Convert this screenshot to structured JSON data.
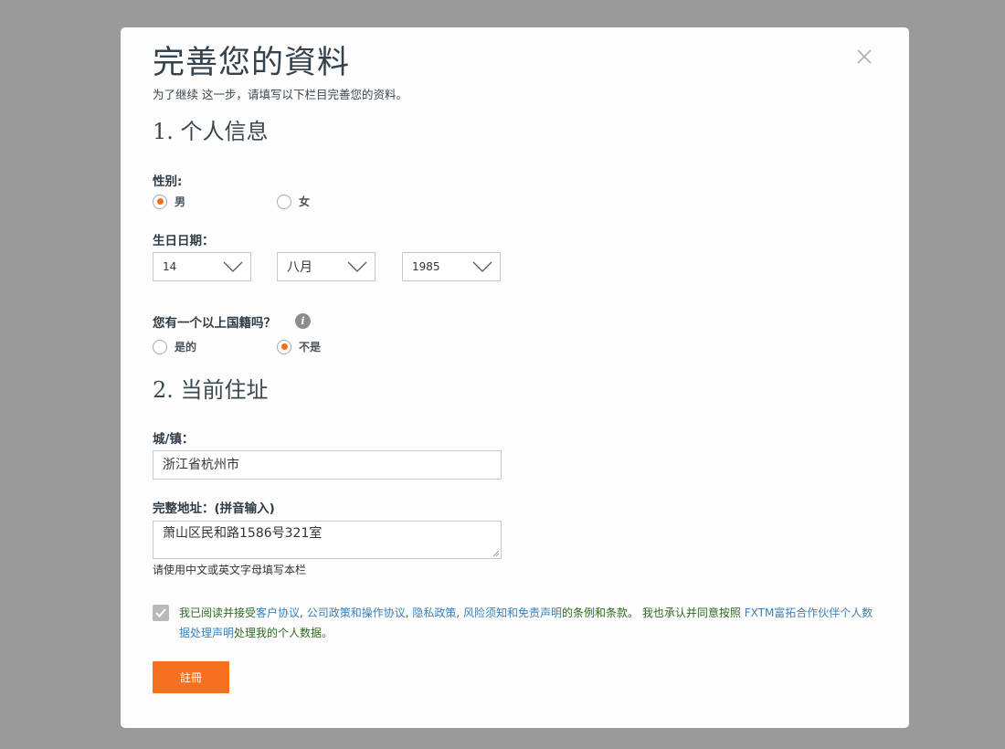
{
  "modal": {
    "title": "完善您的資料",
    "subtitle": "为了继续 这一步，请填写以下栏目完善您的资料。"
  },
  "personal": {
    "section_title": "1. 个人信息",
    "gender_label": "性别:",
    "gender_options": [
      {
        "label": "男",
        "checked": true
      },
      {
        "label": "女",
        "checked": false
      }
    ],
    "birthday_label": "生日日期：",
    "birthday": {
      "day": "14",
      "month": "八月",
      "year": "1985"
    },
    "nationality_label": "您有一个以上国籍吗？",
    "nationality_options": [
      {
        "label": "是的",
        "checked": false
      },
      {
        "label": "不是",
        "checked": true
      }
    ]
  },
  "address": {
    "section_title": "2. 当前住址",
    "city_label": "城/镇：",
    "city_value": "浙江省杭州市",
    "full_label": "完整地址：(拼音输入)",
    "full_value": "萧山区民和路1586号321室",
    "hint": "请使用中文或英文字母填写本栏"
  },
  "terms": {
    "checked": true,
    "part1": "我已阅读并接受",
    "link1": "客户协议",
    "sep1": ",",
    "link2": "公司政策和操作协议",
    "sep2": ",",
    "link3": "隐私政策",
    "sep3": ",",
    "link4": "风险须知和免责声明",
    "part2": "的条例和条款。 我也承认并同意按照",
    "link5": "FXTM富拓合作伙伴个人数据处理声明",
    "part3": "处理我的个人数据。"
  },
  "submit_label": "註冊",
  "colors": {
    "accent": "#f26f21",
    "overlay": "#9a9a9a",
    "link": "#3d7fb5",
    "terms_text": "#2c6b1f"
  }
}
